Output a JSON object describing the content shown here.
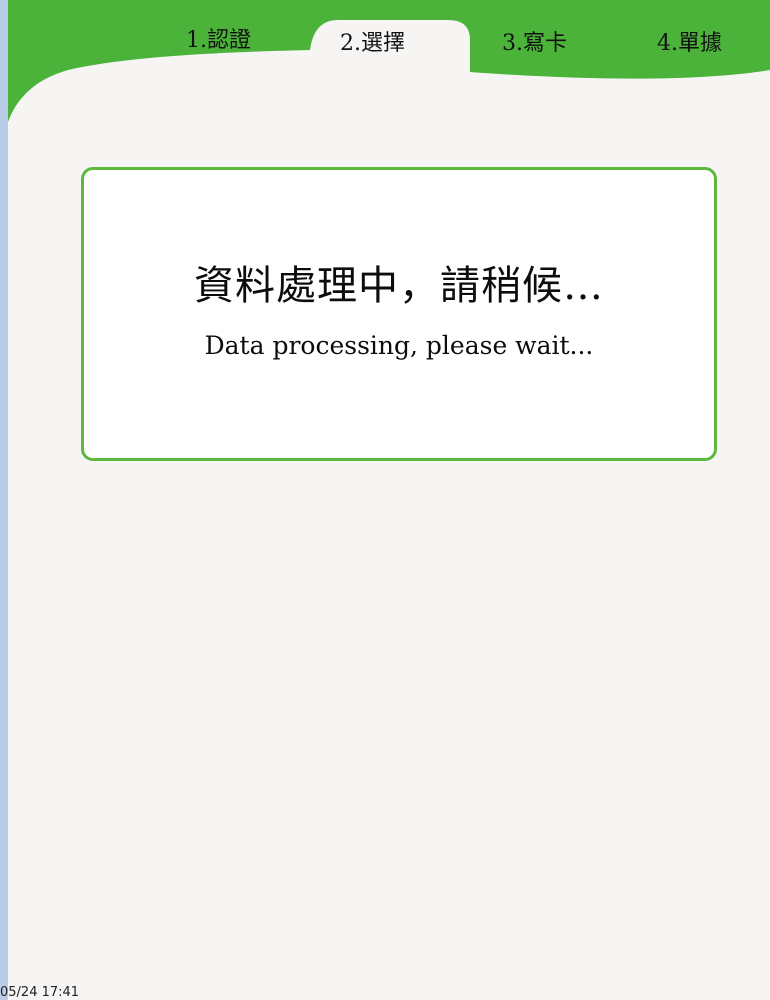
{
  "steps": [
    {
      "label": "1.認證"
    },
    {
      "label": "2.選擇"
    },
    {
      "label": "3.寫卡"
    },
    {
      "label": "4.單據"
    }
  ],
  "active_step": 2,
  "message": {
    "zh": "資料處理中，請稍候…",
    "en": "Data processing, please wait..."
  },
  "status": {
    "datetime": "05/24 17:41"
  },
  "colors": {
    "header_green": "#4cb33a",
    "border_green": "#5cb83e",
    "background": "#f6f5f3",
    "side_strip": "#b9cde6"
  }
}
